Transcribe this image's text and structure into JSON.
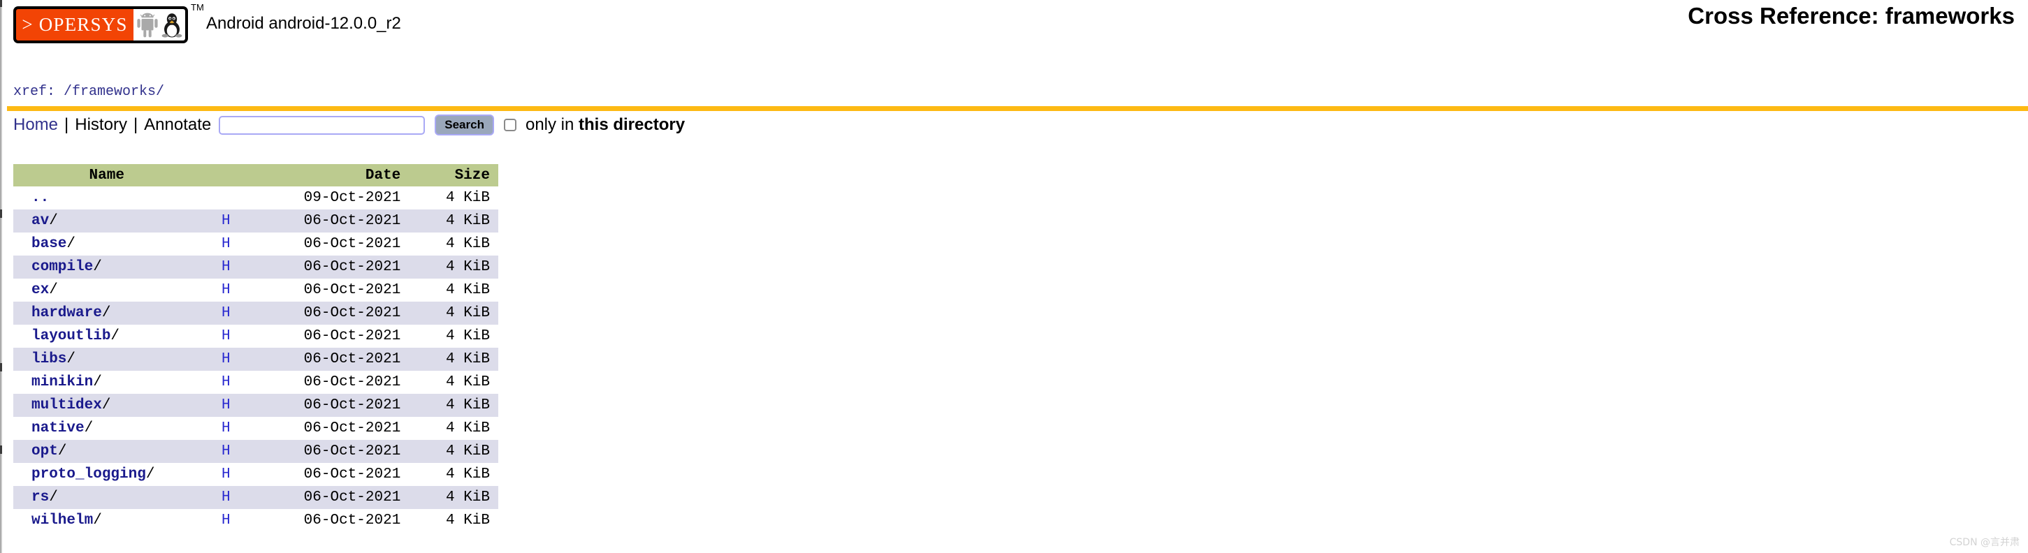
{
  "masthead": {
    "logo_text": "> OPERSYS",
    "logo_tm": "TM",
    "logo_icons": [
      "android-robot-icon",
      "linux-penguin-icon"
    ],
    "product_title": "Android android-12.0.0_r2",
    "xref_title": "Cross Reference: frameworks"
  },
  "breadcrumb": {
    "prefix": "xref:",
    "path": "/frameworks/",
    "full": "xref: /frameworks/"
  },
  "nav": {
    "home_label": "Home",
    "separator": "|",
    "history_label": "History",
    "annotate_label": "Annotate"
  },
  "search": {
    "value": "",
    "placeholder": "",
    "button_label": "Search",
    "checkbox_checked": false,
    "checkbox_label_plain": "only in ",
    "checkbox_label_bold": "this directory"
  },
  "table": {
    "columns": [
      "Name",
      "",
      "Date",
      "Size"
    ],
    "rows": [
      {
        "name": "..",
        "slash": "",
        "h": "",
        "date": "09-Oct-2021",
        "size": "4 KiB",
        "alt": false,
        "parent": true
      },
      {
        "name": "av",
        "slash": "/",
        "h": "H",
        "date": "06-Oct-2021",
        "size": "4 KiB",
        "alt": true,
        "parent": false
      },
      {
        "name": "base",
        "slash": "/",
        "h": "H",
        "date": "06-Oct-2021",
        "size": "4 KiB",
        "alt": false,
        "parent": false
      },
      {
        "name": "compile",
        "slash": "/",
        "h": "H",
        "date": "06-Oct-2021",
        "size": "4 KiB",
        "alt": true,
        "parent": false
      },
      {
        "name": "ex",
        "slash": "/",
        "h": "H",
        "date": "06-Oct-2021",
        "size": "4 KiB",
        "alt": false,
        "parent": false
      },
      {
        "name": "hardware",
        "slash": "/",
        "h": "H",
        "date": "06-Oct-2021",
        "size": "4 KiB",
        "alt": true,
        "parent": false
      },
      {
        "name": "layoutlib",
        "slash": "/",
        "h": "H",
        "date": "06-Oct-2021",
        "size": "4 KiB",
        "alt": false,
        "parent": false
      },
      {
        "name": "libs",
        "slash": "/",
        "h": "H",
        "date": "06-Oct-2021",
        "size": "4 KiB",
        "alt": true,
        "parent": false
      },
      {
        "name": "minikin",
        "slash": "/",
        "h": "H",
        "date": "06-Oct-2021",
        "size": "4 KiB",
        "alt": false,
        "parent": false
      },
      {
        "name": "multidex",
        "slash": "/",
        "h": "H",
        "date": "06-Oct-2021",
        "size": "4 KiB",
        "alt": true,
        "parent": false
      },
      {
        "name": "native",
        "slash": "/",
        "h": "H",
        "date": "06-Oct-2021",
        "size": "4 KiB",
        "alt": false,
        "parent": false
      },
      {
        "name": "opt",
        "slash": "/",
        "h": "H",
        "date": "06-Oct-2021",
        "size": "4 KiB",
        "alt": true,
        "parent": false
      },
      {
        "name": "proto_logging",
        "slash": "/",
        "h": "H",
        "date": "06-Oct-2021",
        "size": "4 KiB",
        "alt": false,
        "parent": false
      },
      {
        "name": "rs",
        "slash": "/",
        "h": "H",
        "date": "06-Oct-2021",
        "size": "4 KiB",
        "alt": true,
        "parent": false
      },
      {
        "name": "wilhelm",
        "slash": "/",
        "h": "H",
        "date": "06-Oct-2021",
        "size": "4 KiB",
        "alt": false,
        "parent": false
      }
    ]
  },
  "watermark": {
    "text": "CSDN @言并肃"
  },
  "colors": {
    "logo_orange": "#f24405",
    "rule_orange": "#fdb913",
    "table_header_green": "#bccb8f",
    "row_alt_lavender": "#dcdcea",
    "link_blue": "#1a1a8c",
    "h_link_blue": "#2a2ad0",
    "search_button_grey": "#9aa7bb",
    "input_border_lavender": "#a9a9f5"
  }
}
